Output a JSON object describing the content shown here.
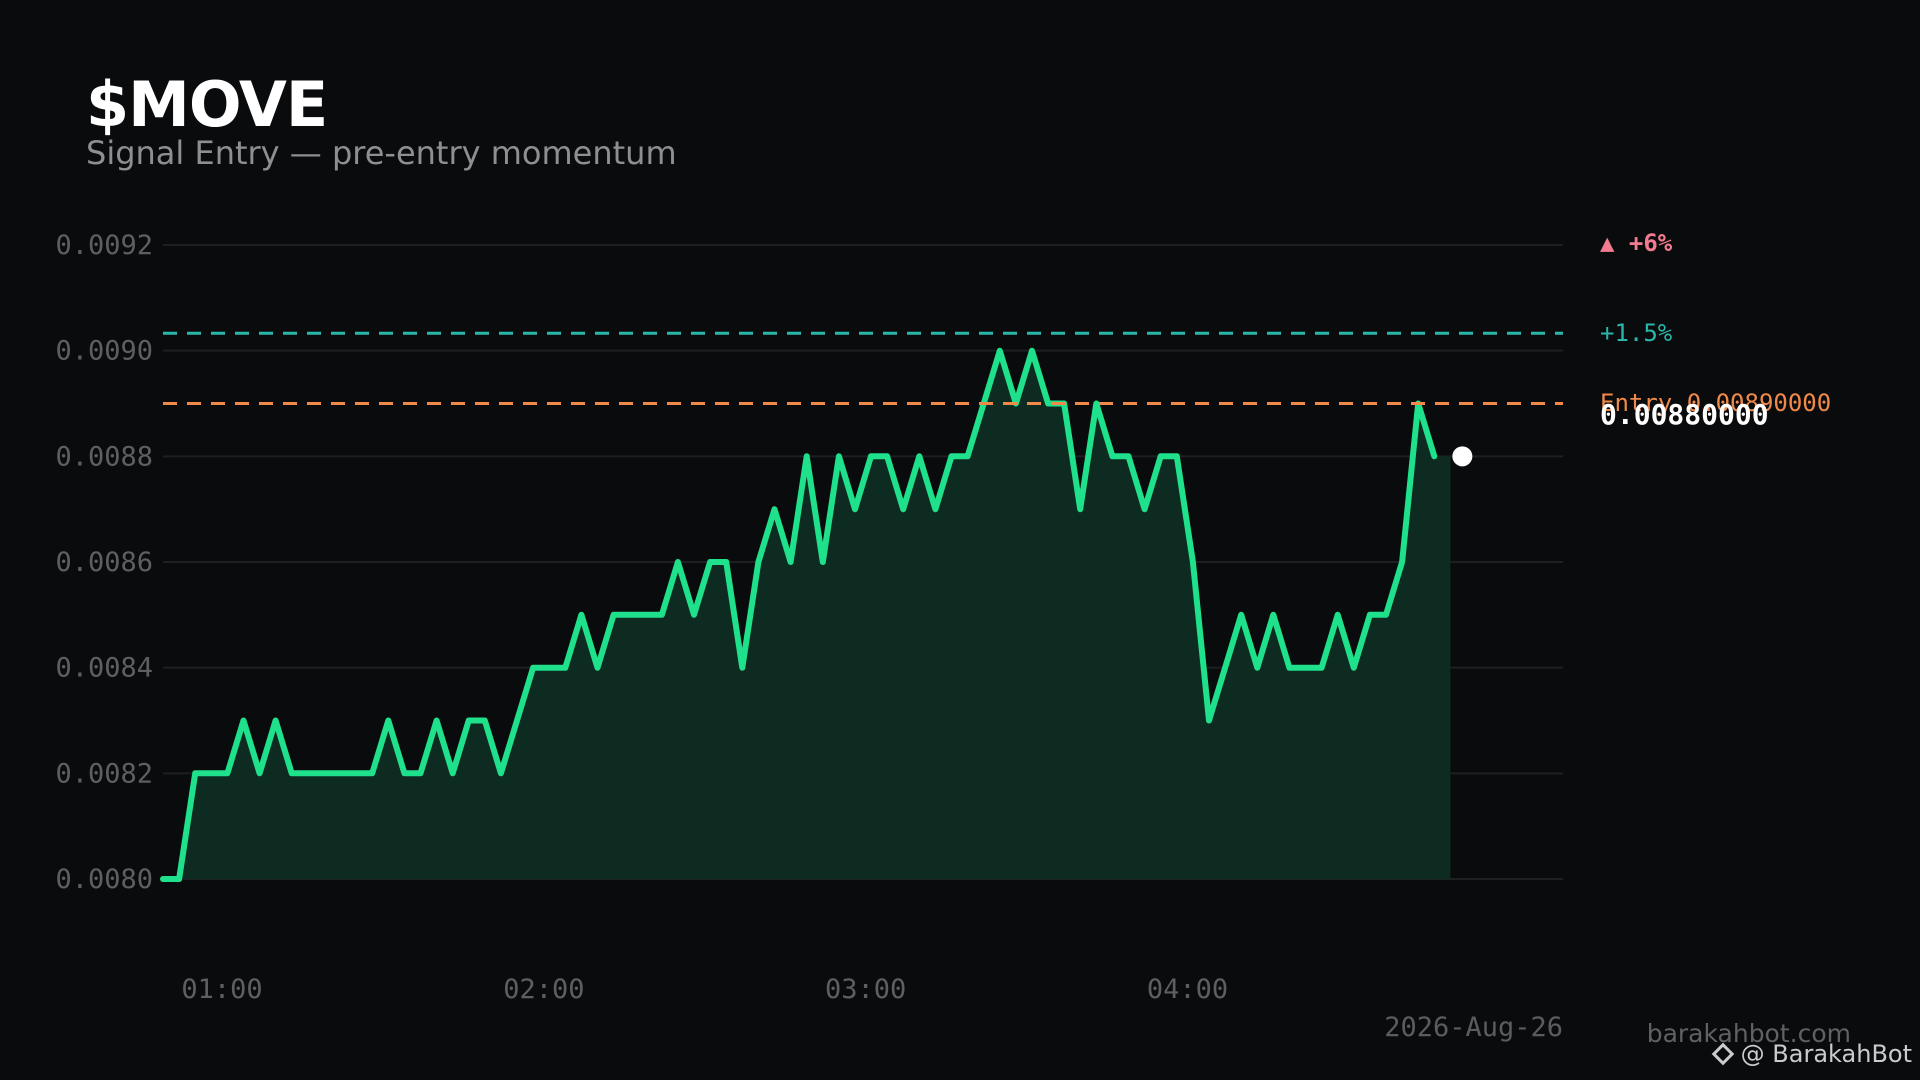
{
  "header": {
    "title": "$MOVE",
    "subtitle": "Signal Entry — pre-entry momentum"
  },
  "annotations": {
    "pct_top": "▲ +6%",
    "tp_label": "+1.5%",
    "entry_label": "Entry 0.00890000",
    "current_price": "0.00880000",
    "date": "2026-Aug-26"
  },
  "branding": {
    "site": "barakahbot.com",
    "handle": "@ BarakahBot",
    "handle_icon": "diamond-icon"
  },
  "colors": {
    "line": "#1fe08b",
    "area": "#0d2b20",
    "tp_line": "#2ab7a9",
    "entry_line": "#f0894a",
    "pct_top": "#f37b8f",
    "grid": "#1d1f23"
  },
  "chart_data": {
    "type": "area",
    "title": "$MOVE",
    "subtitle": "Signal Entry — pre-entry momentum",
    "xlabel": "",
    "ylabel": "",
    "ylim": [
      0.008,
      0.0092
    ],
    "xlim": [
      "00:49",
      "05:10"
    ],
    "grid": true,
    "y_ticks": [
      "0.0080",
      "0.0082",
      "0.0084",
      "0.0086",
      "0.0088",
      "0.0090",
      "0.0092"
    ],
    "x_ticks": [
      "01:00",
      "02:00",
      "03:00",
      "04:00"
    ],
    "reference_lines": [
      {
        "name": "+1.5%",
        "y": 0.009033,
        "color": "#2ab7a9",
        "style": "dashed"
      },
      {
        "name": "Entry 0.00890000",
        "y": 0.0089,
        "color": "#f0894a",
        "style": "dashed"
      }
    ],
    "current_value": 0.0088,
    "x": [
      "00:49",
      "00:52",
      "00:55",
      "00:58",
      "01:01",
      "01:04",
      "01:07",
      "01:10",
      "01:13",
      "01:16",
      "01:19",
      "01:22",
      "01:25",
      "01:28",
      "01:31",
      "01:34",
      "01:37",
      "01:40",
      "01:43",
      "01:46",
      "01:49",
      "01:52",
      "01:55",
      "01:58",
      "02:01",
      "02:04",
      "02:07",
      "02:10",
      "02:13",
      "02:16",
      "02:19",
      "02:22",
      "02:25",
      "02:28",
      "02:31",
      "02:34",
      "02:37",
      "02:40",
      "02:43",
      "02:46",
      "02:49",
      "02:52",
      "02:55",
      "02:58",
      "03:01",
      "03:04",
      "03:07",
      "03:10",
      "03:13",
      "03:16",
      "03:19",
      "03:22",
      "03:25",
      "03:28",
      "03:31",
      "03:34",
      "03:37",
      "03:40",
      "03:43",
      "03:46",
      "03:49",
      "03:52",
      "03:55",
      "03:58",
      "04:01",
      "04:04",
      "04:07",
      "04:10",
      "04:13",
      "04:16",
      "04:19",
      "04:22",
      "04:25",
      "04:28",
      "04:31",
      "04:34",
      "04:37",
      "04:40",
      "04:43",
      "04:46"
    ],
    "values": [
      0.008,
      0.008,
      0.0082,
      0.0082,
      0.0082,
      0.0083,
      0.0082,
      0.0083,
      0.0082,
      0.0082,
      0.0082,
      0.0082,
      0.0082,
      0.0082,
      0.0083,
      0.0082,
      0.0082,
      0.0083,
      0.0082,
      0.0083,
      0.0083,
      0.0082,
      0.0083,
      0.0084,
      0.0084,
      0.0084,
      0.0085,
      0.0084,
      0.0085,
      0.0085,
      0.0085,
      0.0085,
      0.0086,
      0.0085,
      0.0086,
      0.0086,
      0.0084,
      0.0086,
      0.0087,
      0.0086,
      0.0088,
      0.0086,
      0.0088,
      0.0087,
      0.0088,
      0.0088,
      0.0087,
      0.0088,
      0.0087,
      0.0088,
      0.0088,
      0.0089,
      0.009,
      0.0089,
      0.009,
      0.0089,
      0.0089,
      0.0087,
      0.0089,
      0.0088,
      0.0088,
      0.0087,
      0.0088,
      0.0088,
      0.0086,
      0.0083,
      0.0084,
      0.0085,
      0.0084,
      0.0085,
      0.0084,
      0.0084,
      0.0084,
      0.0085,
      0.0084,
      0.0085,
      0.0085,
      0.0086,
      0.0089,
      0.0088
    ]
  }
}
